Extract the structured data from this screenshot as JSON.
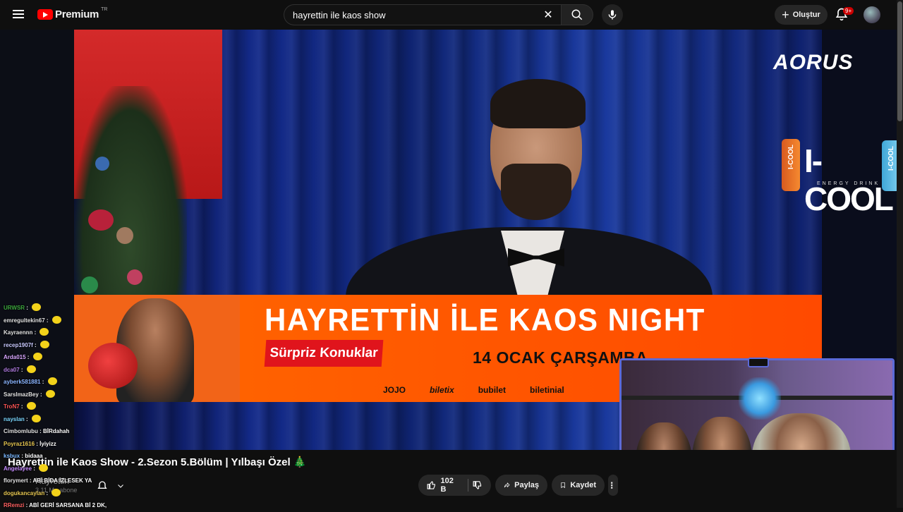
{
  "header": {
    "logo_text": "Premium",
    "logo_superscript": "TR",
    "search_value": "hayrettin ile kaos show",
    "create_label": "Oluştur",
    "notifications_badge": "9+"
  },
  "overlay": {
    "aorus_text": "AORUS",
    "icool_text": "I-COOL",
    "icool_can_text": "I-COOL",
    "icool_sub": "ENERGY DRINK"
  },
  "banner": {
    "title": "HAYRETTİN İLE KAOS NIGHT",
    "surprise": "Sürpriz Konuklar",
    "date": "14 OCAK ÇARŞAMBA",
    "sponsors": [
      "JOJO",
      "biletix",
      "bubilet",
      "biletinial"
    ]
  },
  "chat": [
    {
      "name": "URWSR",
      "color": "#3ba53b",
      "msg": ""
    },
    {
      "name": "emregultekin67",
      "color": "#e0e0e0",
      "msg": ""
    },
    {
      "name": "Kayraennn",
      "color": "#e0e0e0",
      "msg": ""
    },
    {
      "name": "recep1907f",
      "color": "#c9c9ff",
      "msg": ""
    },
    {
      "name": "Arda015",
      "color": "#d9a6ff",
      "msg": ""
    },
    {
      "name": "dca07",
      "color": "#b07ae0",
      "msg": ""
    },
    {
      "name": "ayberk581881",
      "color": "#8ab4ff",
      "msg": ""
    },
    {
      "name": "SarsImazBey",
      "color": "#e0e0e0",
      "msg": ""
    },
    {
      "name": "TroN7",
      "color": "#ff5555",
      "msg": ""
    },
    {
      "name": "nayslan",
      "color": "#7ad7ff",
      "msg": ""
    },
    {
      "name": "Cimbomlubu",
      "color": "#e0e0e0",
      "msg": "BİRdahah"
    },
    {
      "name": "Poyraz1616",
      "color": "#e6c650",
      "msg": "İyiyizz"
    },
    {
      "name": "ksbux",
      "color": "#7ab8ff",
      "msg": "bidaaa"
    },
    {
      "name": "Angelayee",
      "color": "#c58aff",
      "msg": ""
    },
    {
      "name": "florymert",
      "color": "#e0e0e0",
      "msg": "ABİ BİDA İZLESEK YA"
    },
    {
      "name": "dogukancaylan",
      "color": "#e6c650",
      "msg": ""
    },
    {
      "name": "RRemzi",
      "color": "#ff6060",
      "msg": "ABİ GERİ SARSANA Bİ 2 DK,"
    }
  ],
  "video": {
    "title": "Hayrettin ile Kaos Show - 2.Sezon 5.Bölüm | Yılbaşı Özel 🎄",
    "channel": "Hayrettin",
    "subscribers": "3,11 Mn abone",
    "likes": "102 B",
    "share_label": "Paylaş",
    "save_label": "Kaydet"
  },
  "colors": {
    "accent_red": "#ff0000",
    "banner_orange": "#ff5a00",
    "facecam_border": "#5c6ad8"
  }
}
